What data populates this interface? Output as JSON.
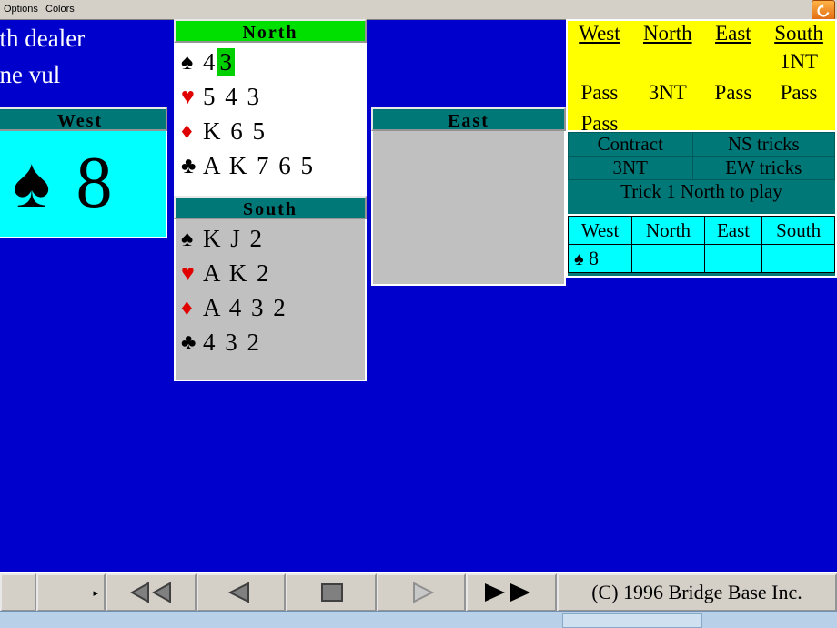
{
  "menu": {
    "items": [
      {
        "label": "Options",
        "accel": "O"
      },
      {
        "label": "Colors",
        "accel": "C"
      }
    ],
    "restore_icon": "restore-window-icon"
  },
  "deal_info": {
    "dealer_line": "uth dealer",
    "vul_line": "one vul"
  },
  "hands": {
    "north": {
      "title": "North",
      "suits": [
        {
          "symbol": "♠",
          "color": "black",
          "cards": "4 ",
          "highlight": "3"
        },
        {
          "symbol": "♥",
          "color": "red",
          "cards": "5 4 3",
          "highlight": ""
        },
        {
          "symbol": "♦",
          "color": "red",
          "cards": "K 6 5",
          "highlight": ""
        },
        {
          "symbol": "♣",
          "color": "black",
          "cards": "A K 7 6 5",
          "highlight": ""
        }
      ]
    },
    "south": {
      "title": "South",
      "suits": [
        {
          "symbol": "♠",
          "color": "black",
          "cards": "K J 2",
          "highlight": ""
        },
        {
          "symbol": "♥",
          "color": "red",
          "cards": "A K 2",
          "highlight": ""
        },
        {
          "symbol": "♦",
          "color": "red",
          "cards": "A 4 3 2",
          "highlight": ""
        },
        {
          "symbol": "♣",
          "color": "black",
          "cards": "4 3 2",
          "highlight": ""
        }
      ]
    },
    "west": {
      "title": "West",
      "played_suit": "♠",
      "played_rank": "8"
    },
    "east": {
      "title": "East"
    }
  },
  "auction": {
    "headers": [
      "West",
      "North",
      "East",
      "South"
    ],
    "rows": [
      [
        "",
        "",
        "",
        "1NT"
      ],
      [
        "Pass",
        "3NT",
        "Pass",
        "Pass"
      ],
      [
        "Pass",
        "",
        "",
        ""
      ]
    ]
  },
  "contract_panel": {
    "contract_label": "Contract",
    "contract_value": "3NT",
    "ns_tricks_label": "NS tricks",
    "ns_tricks_value": "",
    "ew_tricks_label": "EW tricks",
    "ew_tricks_value": "",
    "status_line": "Trick 1 North to play"
  },
  "trick_table": {
    "headers": [
      "West",
      "North",
      "East",
      "South"
    ],
    "cells": [
      {
        "symbol": "♠",
        "color": "black",
        "rank": "8"
      },
      {
        "symbol": "",
        "color": "black",
        "rank": ""
      },
      {
        "symbol": "",
        "color": "black",
        "rank": ""
      },
      {
        "symbol": "",
        "color": "black",
        "rank": ""
      }
    ]
  },
  "toolbar": {
    "buttons": [
      {
        "name": "rewind-all-button",
        "icon": "double-left-triangle-icon"
      },
      {
        "name": "step-back-button",
        "icon": "left-triangle-icon"
      },
      {
        "name": "stop-button",
        "icon": "square-icon"
      },
      {
        "name": "step-forward-button",
        "icon": "right-triangle-outline-icon"
      },
      {
        "name": "forward-all-button",
        "icon": "double-right-triangle-icon"
      }
    ],
    "scroll_arrow": "▸",
    "copyright": "(C) 1996 Bridge Base Inc."
  },
  "colors": {
    "background": "#0000cc",
    "north_header": "#00e000",
    "panel_header": "#007878",
    "auction_bg": "#ffff00",
    "trick_bg": "#00ffff",
    "highlight": "#00d000",
    "red_suit": "#e00000"
  }
}
